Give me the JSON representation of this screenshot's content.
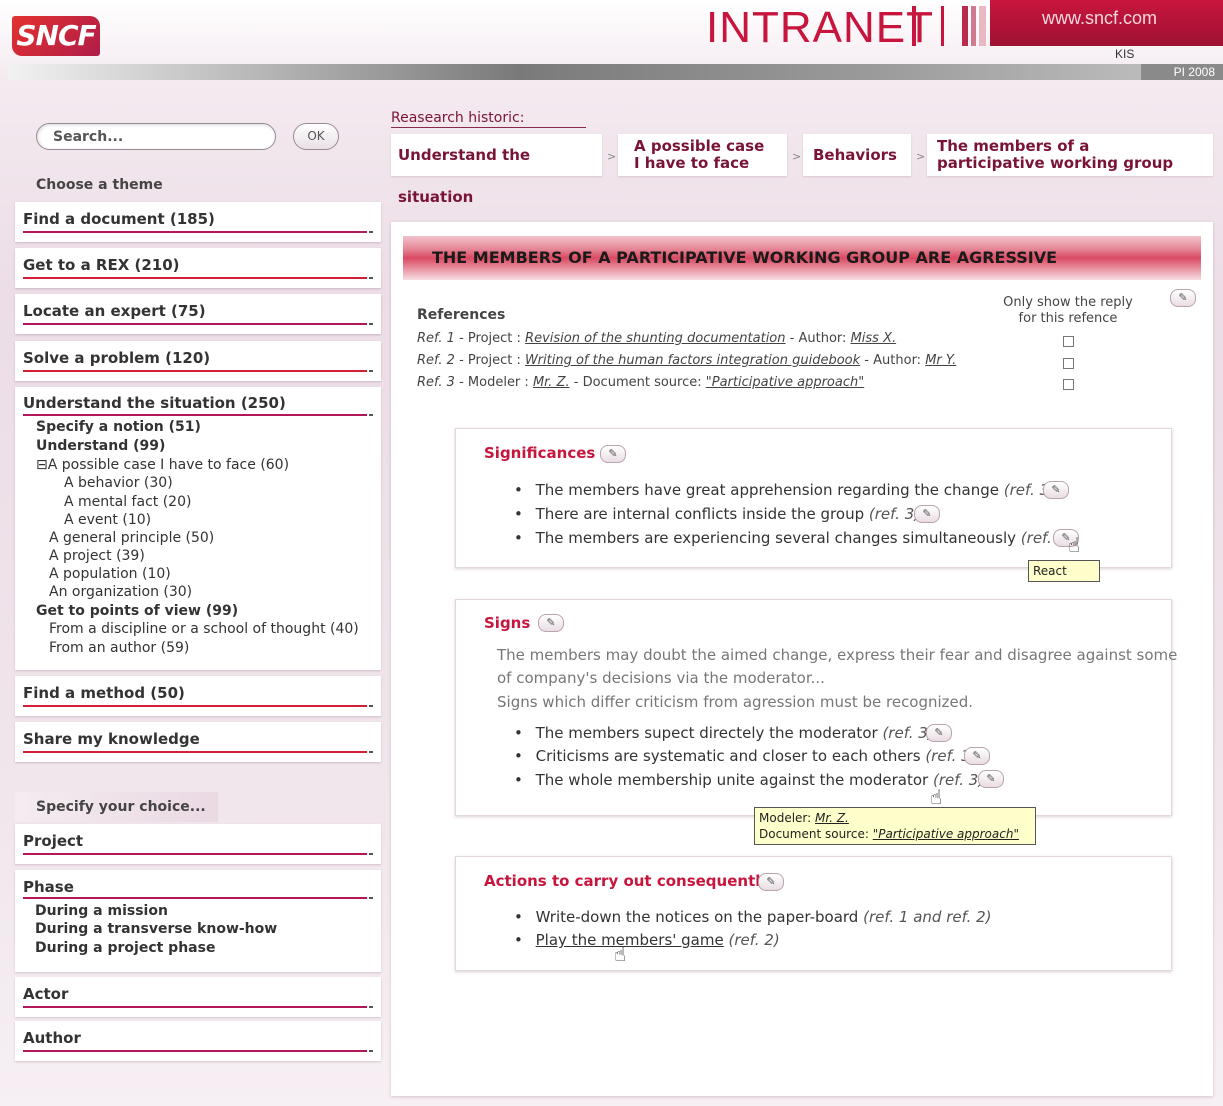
{
  "header": {
    "logo": "SNCF",
    "intranet": "INTRANET",
    "site": "www.sncf.com",
    "kis": "KIS",
    "version": "PI 2008"
  },
  "search": {
    "placeholder": "Search...",
    "ok_label": "OK"
  },
  "sidebar": {
    "choose_theme": "Choose a theme",
    "themes": [
      "Find a document (185)",
      "Get to a REX (210)",
      "Locate an expert (75)",
      "Solve a problem (120)",
      "Understand the situation (250)",
      "Find a method (50)",
      "Share my knowledge"
    ],
    "tree": [
      "Specify a notion (51)",
      "Understand (99)",
      "⊟A possible case I have to face (60)",
      "A behavior (30)",
      "A mental fact (20)",
      "A event (10)",
      "A general principle (50)",
      "A project (39)",
      "A population (10)",
      "An organization (30)",
      "Get to points of view (99)",
      "From a discipline or a school of thought (40)",
      "From an author (59)"
    ],
    "specify_choice": "Specify your choice...",
    "filters": [
      "Project",
      "Phase",
      "Actor",
      "Author"
    ],
    "phase_items": [
      "During a mission",
      "During a transverse know-how",
      "During a project phase"
    ]
  },
  "breadcrumb": {
    "label": "Reasearch historic:",
    "items": [
      "Understand the situation",
      "A possible case",
      "I have to face",
      "Behaviors",
      "The members of a",
      "participative working group"
    ],
    "sep": ">"
  },
  "page": {
    "title": "THE MEMBERS OF A PARTICIPATIVE WORKING GROUP ARE AGRESSIVE",
    "references_label": "References",
    "only_show_1": "Only show the reply",
    "only_show_2": "for this refence",
    "refs": [
      {
        "ref": "Ref. 1",
        "k1": "Project :",
        "v1": "Revision of the shunting documentation",
        "k2": "Author:",
        "v2": "Miss X."
      },
      {
        "ref": "Ref. 2",
        "k1": "Project :",
        "v1": "Writing of the human factors integration guidebook",
        "k2": "Author:",
        "v2": "Mr Y."
      },
      {
        "ref": "Ref. 3",
        "k1": "Modeler :",
        "v1": "Mr. Z.",
        "k2": "Document source:",
        "v2": "\"Participative approach\""
      }
    ],
    "dash": "-",
    "edit_icon": "✎"
  },
  "significances": {
    "title": "Significances",
    "items": [
      {
        "text": "The members have great apprehension regarding the change",
        "ref": "(ref. 3)"
      },
      {
        "text": "There are internal conflicts inside the group",
        "ref": "(ref. 3)"
      },
      {
        "text": "The members are experiencing several changes simultaneously",
        "ref": "(ref. 3)"
      }
    ],
    "tooltip": "React"
  },
  "signs": {
    "title": "Signs",
    "desc1": "The members may doubt the aimed change, express their fear and disagree against some",
    "desc2": "of company's decisions via the moderator...",
    "desc3": "Signs which differ criticism from agression must be recognized.",
    "items": [
      {
        "text": "The members supect directely the moderator",
        "ref": "(ref. 3)"
      },
      {
        "text": "Criticisms are systematic and closer to each others",
        "ref": "(ref. 3)"
      },
      {
        "text": "The whole membership unite against the moderator",
        "ref": "(ref. 3)"
      }
    ],
    "tooltip_k1": "Modeler:",
    "tooltip_v1": "Mr. Z.",
    "tooltip_k2": "Document source:",
    "tooltip_v2": "\"Participative approach\""
  },
  "actions": {
    "title": "Actions to carry out consequently",
    "items": [
      {
        "text": "Write-down the notices on the paper-board",
        "ref": "(ref. 1 and ref. 2)"
      },
      {
        "text": "Play the members' game",
        "ref": "(ref. 2)"
      }
    ]
  },
  "colors": {
    "brand": "#c8153d",
    "accent": "#b2175a"
  }
}
